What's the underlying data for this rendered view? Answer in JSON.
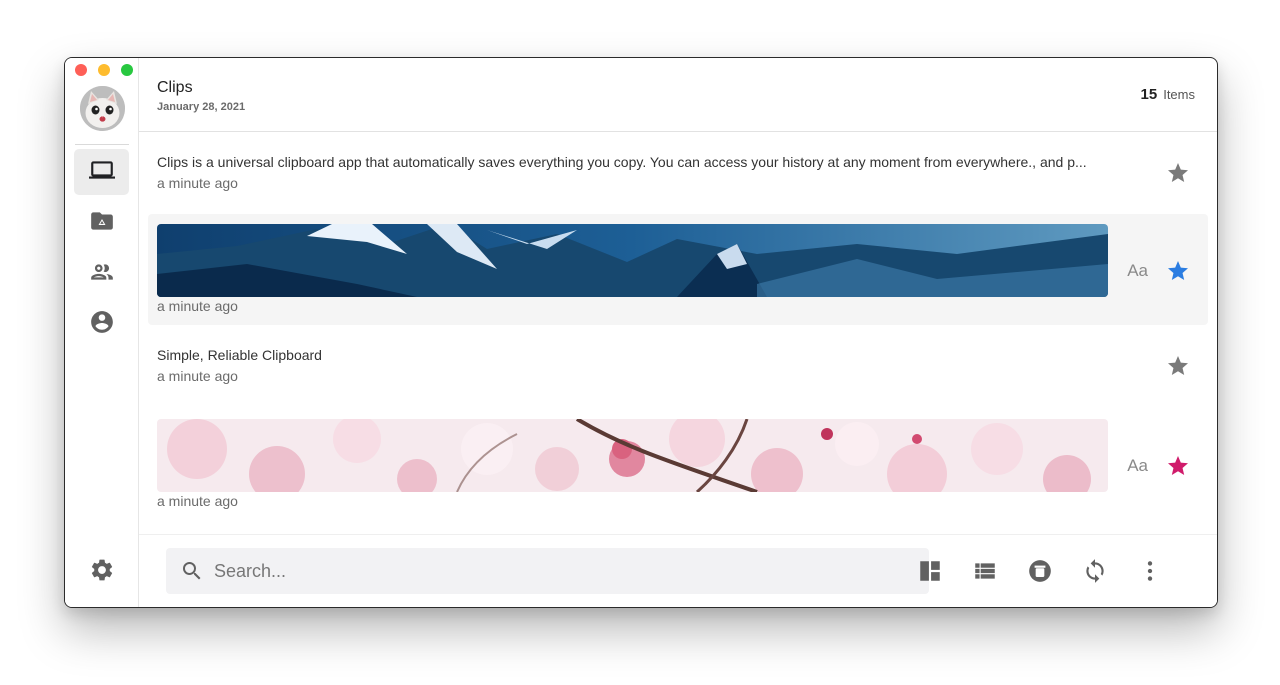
{
  "header": {
    "title": "Clips",
    "date": "January 28, 2021",
    "count": "15",
    "count_label": "Items"
  },
  "sidebar": {
    "items": [
      {
        "icon": "laptop-icon",
        "active": true
      },
      {
        "icon": "folder-drive-icon",
        "active": false
      },
      {
        "icon": "people-icon",
        "active": false
      },
      {
        "icon": "account-circle-icon",
        "active": false
      }
    ],
    "settings_icon": "gear-icon"
  },
  "clips": [
    {
      "type": "text",
      "text": "Clips is a universal clipboard app that automatically saves everything you copy. You can access your history at any moment from everywhere., and p...",
      "time": "a minute ago",
      "starred": false,
      "star_color": "#7a7a7a"
    },
    {
      "type": "image",
      "image": "snowy blue mountains",
      "aa_label": "Aa",
      "time": "a minute ago",
      "starred": true,
      "star_color": "#2b7de1"
    },
    {
      "type": "text",
      "text": "Simple, Reliable Clipboard",
      "time": "a minute ago",
      "starred": false,
      "star_color": "#7a7a7a"
    },
    {
      "type": "image",
      "image": "pink cherry blossoms",
      "aa_label": "Aa",
      "time": "a minute ago",
      "starred": true,
      "star_color": "#d01b6b"
    }
  ],
  "search": {
    "placeholder": "Search..."
  },
  "toolbar": {
    "icons": [
      "dashboard-view-icon",
      "list-view-icon",
      "delete-icon",
      "sync-icon",
      "more-vert-icon"
    ]
  },
  "colors": {
    "icon_gray": "#616161",
    "star_gray": "#7a7a7a",
    "star_blue": "#2b7de1",
    "star_pink": "#d01b6b"
  }
}
